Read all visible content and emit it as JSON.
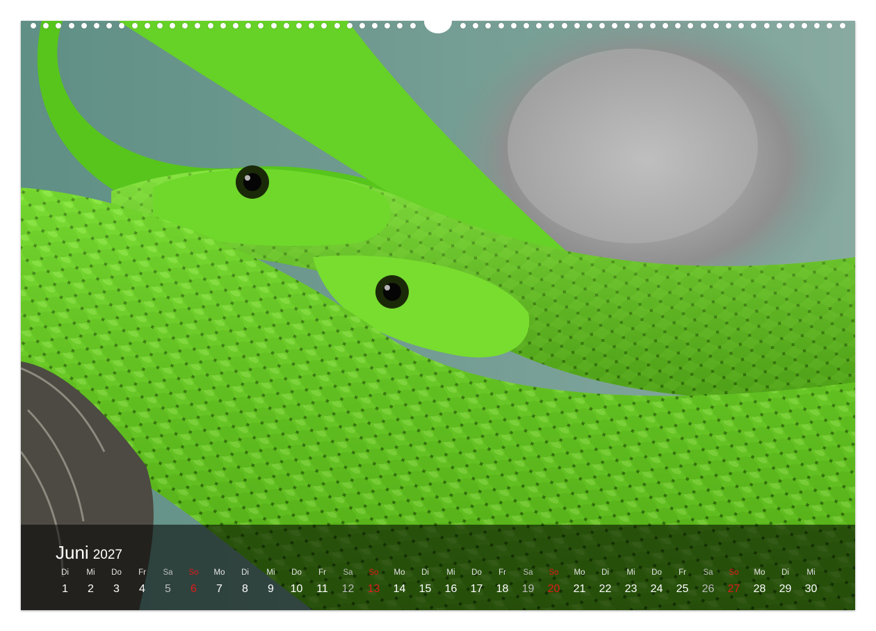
{
  "calendar": {
    "month": "Juni",
    "year": "2027",
    "days": [
      {
        "wd": "Di",
        "d": "1",
        "t": "weekday"
      },
      {
        "wd": "Mi",
        "d": "2",
        "t": "weekday"
      },
      {
        "wd": "Do",
        "d": "3",
        "t": "weekday"
      },
      {
        "wd": "Fr",
        "d": "4",
        "t": "weekday"
      },
      {
        "wd": "Sa",
        "d": "5",
        "t": "sat"
      },
      {
        "wd": "So",
        "d": "6",
        "t": "sun"
      },
      {
        "wd": "Mo",
        "d": "7",
        "t": "weekday"
      },
      {
        "wd": "Di",
        "d": "8",
        "t": "weekday"
      },
      {
        "wd": "Mi",
        "d": "9",
        "t": "weekday"
      },
      {
        "wd": "Do",
        "d": "10",
        "t": "weekday"
      },
      {
        "wd": "Fr",
        "d": "11",
        "t": "weekday"
      },
      {
        "wd": "Sa",
        "d": "12",
        "t": "sat"
      },
      {
        "wd": "So",
        "d": "13",
        "t": "sun"
      },
      {
        "wd": "Mo",
        "d": "14",
        "t": "weekday"
      },
      {
        "wd": "Di",
        "d": "15",
        "t": "weekday"
      },
      {
        "wd": "Mi",
        "d": "16",
        "t": "weekday"
      },
      {
        "wd": "Do",
        "d": "17",
        "t": "weekday"
      },
      {
        "wd": "Fr",
        "d": "18",
        "t": "weekday"
      },
      {
        "wd": "Sa",
        "d": "19",
        "t": "sat"
      },
      {
        "wd": "So",
        "d": "20",
        "t": "sun"
      },
      {
        "wd": "Mo",
        "d": "21",
        "t": "weekday"
      },
      {
        "wd": "Di",
        "d": "22",
        "t": "weekday"
      },
      {
        "wd": "Mi",
        "d": "23",
        "t": "weekday"
      },
      {
        "wd": "Do",
        "d": "24",
        "t": "weekday"
      },
      {
        "wd": "Fr",
        "d": "25",
        "t": "weekday"
      },
      {
        "wd": "Sa",
        "d": "26",
        "t": "sat"
      },
      {
        "wd": "So",
        "d": "27",
        "t": "sun"
      },
      {
        "wd": "Mo",
        "d": "28",
        "t": "weekday"
      },
      {
        "wd": "Di",
        "d": "29",
        "t": "weekday"
      },
      {
        "wd": "Mi",
        "d": "30",
        "t": "weekday"
      }
    ]
  },
  "colors": {
    "sunday": "#e21b1b",
    "saturday": "#bdbdbd",
    "snake_green": "#5fd11a"
  }
}
